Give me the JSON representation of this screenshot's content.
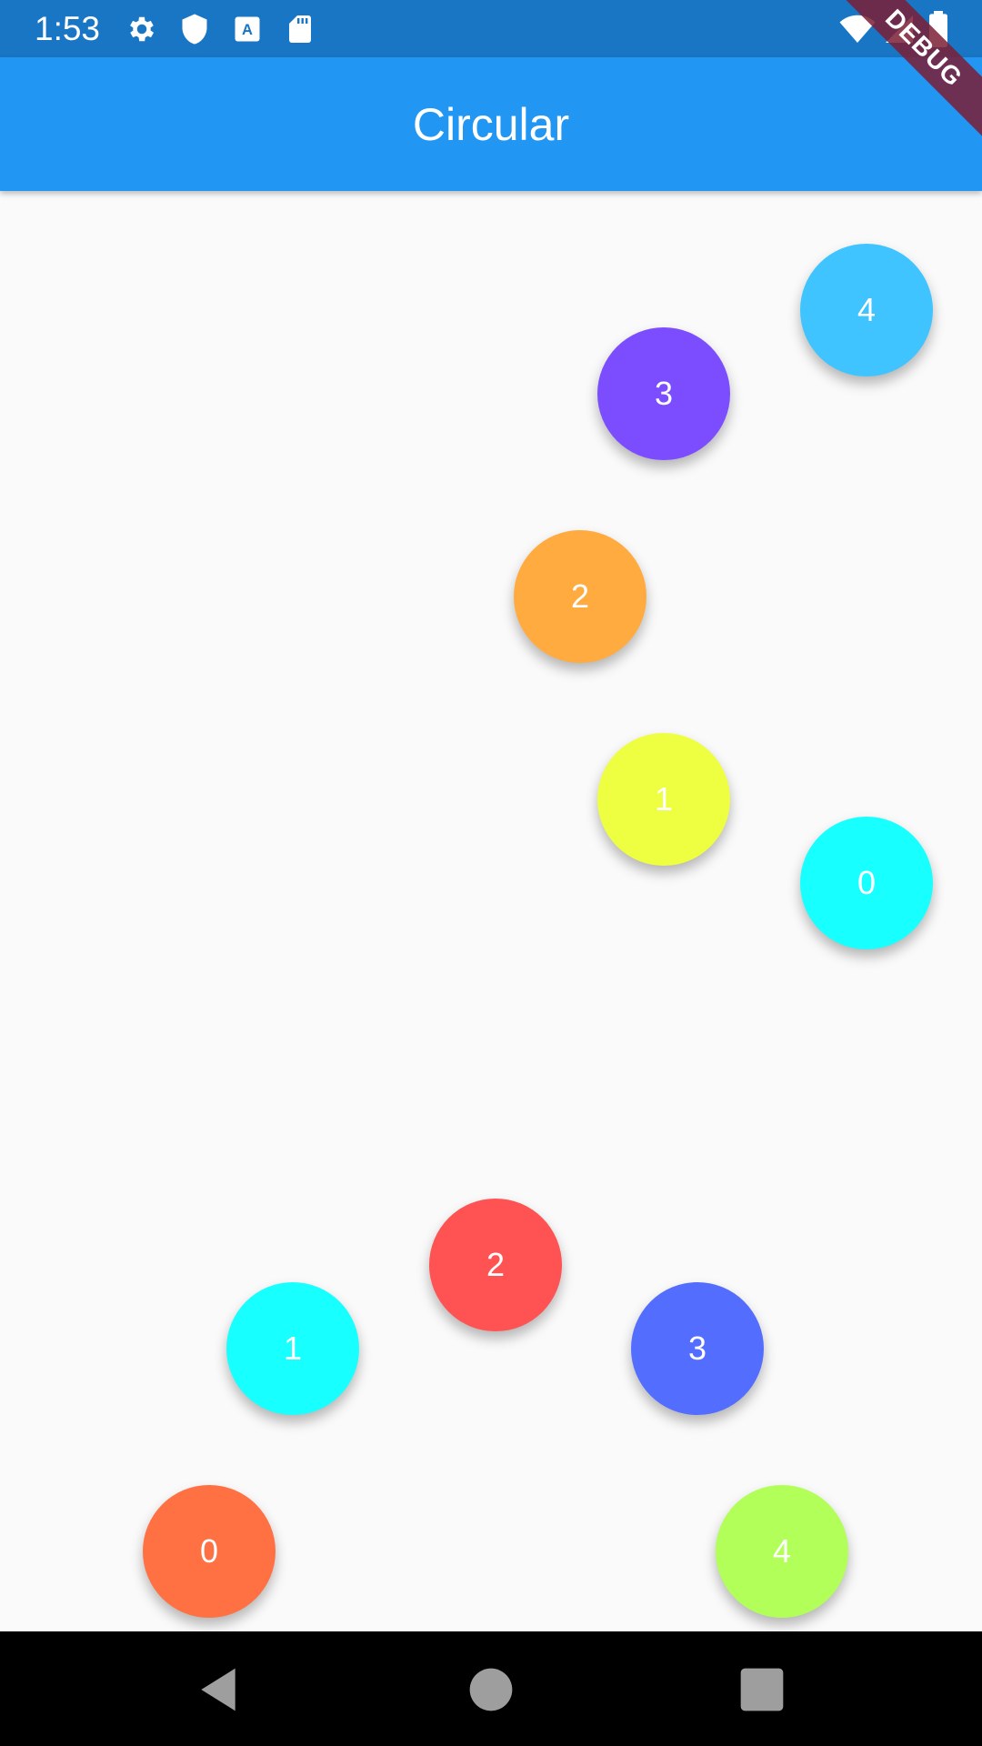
{
  "status_bar": {
    "time": "1:53",
    "left_icons": [
      "gear-icon",
      "shield-icon",
      "font-download-icon",
      "sd-card-icon"
    ],
    "right_icons": [
      "wifi-icon",
      "cell-signal-icon",
      "battery-icon"
    ],
    "background": "#1976c5"
  },
  "app_bar": {
    "title": "Circular",
    "background": "#2196f3"
  },
  "debug_banner": {
    "label": "DEBUG"
  },
  "top_group": {
    "buttons": [
      {
        "label": "4",
        "color": "#40c4ff"
      },
      {
        "label": "3",
        "color": "#7c4dff"
      },
      {
        "label": "2",
        "color": "#ffab40"
      },
      {
        "label": "1",
        "color": "#eeff41"
      },
      {
        "label": "0",
        "color": "#18ffff"
      }
    ]
  },
  "bottom_group": {
    "buttons": [
      {
        "label": "2",
        "color": "#ff5252"
      },
      {
        "label": "1",
        "color": "#18ffff"
      },
      {
        "label": "3",
        "color": "#536dfe"
      },
      {
        "label": "0",
        "color": "#ff7043"
      },
      {
        "label": "4",
        "color": "#b2ff59"
      }
    ]
  },
  "nav_bar": {
    "buttons": [
      "back-icon",
      "home-icon",
      "recents-icon"
    ]
  }
}
